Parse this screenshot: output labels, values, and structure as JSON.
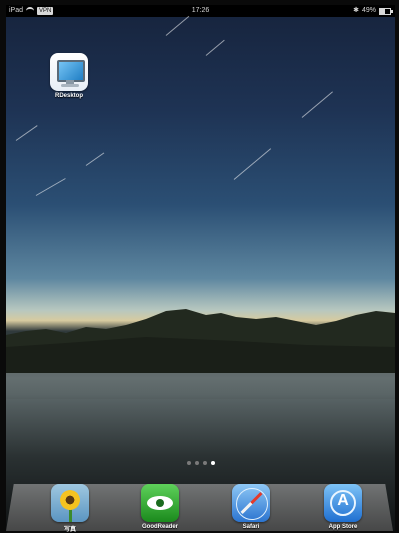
{
  "status_bar": {
    "device": "iPad",
    "vpn": "VPN",
    "time": "17:26",
    "battery": "49%"
  },
  "home_apps": [
    {
      "label": "RDesktop",
      "icon": "rdesktop-icon"
    }
  ],
  "page_indicator": {
    "pages": 4,
    "current": 4
  },
  "dock_apps": [
    {
      "label": "写真",
      "icon": "photos-icon"
    },
    {
      "label": "GoodReader",
      "icon": "goodreader-icon"
    },
    {
      "label": "Safari",
      "icon": "safari-icon"
    },
    {
      "label": "App Store",
      "icon": "app-store-icon"
    }
  ]
}
